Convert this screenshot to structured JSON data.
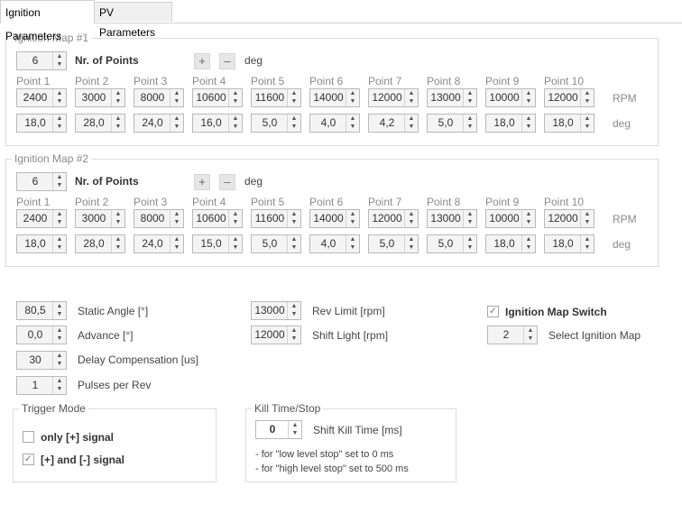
{
  "tabs": [
    {
      "label": "Ignition Parameters",
      "active": true
    },
    {
      "label": "PV Parameters",
      "active": false
    }
  ],
  "map1": {
    "title": "Ignition Map #1",
    "points_value": "6",
    "points_label": "Nr. of Points",
    "plus": "+",
    "minus": "–",
    "deg_label": "deg",
    "point_headers": [
      "Point 1",
      "Point 2",
      "Point 3",
      "Point 4",
      "Point 5",
      "Point 6",
      "Point 7",
      "Point 8",
      "Point 9",
      "Point 10"
    ],
    "rpm": [
      "2400",
      "3000",
      "8000",
      "10600",
      "11600",
      "14000",
      "12000",
      "13000",
      "10000",
      "12000"
    ],
    "rpm_unit": "RPM",
    "deg": [
      "18,0",
      "28,0",
      "24,0",
      "16,0",
      "5,0",
      "4,0",
      "4,2",
      "5,0",
      "18,0",
      "18,0"
    ],
    "deg_unit": "deg"
  },
  "map2": {
    "title": "Ignition Map #2",
    "points_value": "6",
    "points_label": "Nr. of Points",
    "plus": "+",
    "minus": "–",
    "deg_label": "deg",
    "point_headers": [
      "Point 1",
      "Point 2",
      "Point 3",
      "Point 4",
      "Point 5",
      "Point 6",
      "Point 7",
      "Point 8",
      "Point 9",
      "Point 10"
    ],
    "rpm": [
      "2400",
      "3000",
      "8000",
      "10600",
      "11600",
      "14000",
      "12000",
      "13000",
      "10000",
      "12000"
    ],
    "rpm_unit": "RPM",
    "deg": [
      "18,0",
      "28,0",
      "24,0",
      "15,0",
      "5,0",
      "4,0",
      "5,0",
      "5,0",
      "18,0",
      "18,0"
    ],
    "deg_unit": "deg"
  },
  "settings": {
    "static_angle": {
      "value": "80,5",
      "label": "Static Angle [°]"
    },
    "advance": {
      "value": "0,0",
      "label": "Advance [°]"
    },
    "delay": {
      "value": "30",
      "label": "Delay Compensation [us]"
    },
    "pulses": {
      "value": "1",
      "label": "Pulses per Rev"
    },
    "rev_limit": {
      "value": "13000",
      "label": "Rev Limit [rpm]"
    },
    "shift_light": {
      "value": "12000",
      "label": "Shift Light [rpm]"
    },
    "map_switch": {
      "label": "Ignition Map Switch",
      "checked": true
    },
    "select_map": {
      "value": "2",
      "label": "Select Ignition Map"
    }
  },
  "trigger": {
    "title": "Trigger Mode",
    "only_plus": {
      "label": "only [+] signal",
      "checked": false
    },
    "plus_minus": {
      "label": "[+] and [-] signal",
      "checked": true
    }
  },
  "kill": {
    "title": "Kill Time/Stop",
    "value": "0",
    "label": "Shift Kill Time [ms]",
    "note1": "- for \"low level stop\" set to 0 ms",
    "note2": "- for \"high level stop\" set to 500 ms"
  },
  "icons": {
    "up": "▲",
    "down": "▼",
    "check": "✓"
  }
}
